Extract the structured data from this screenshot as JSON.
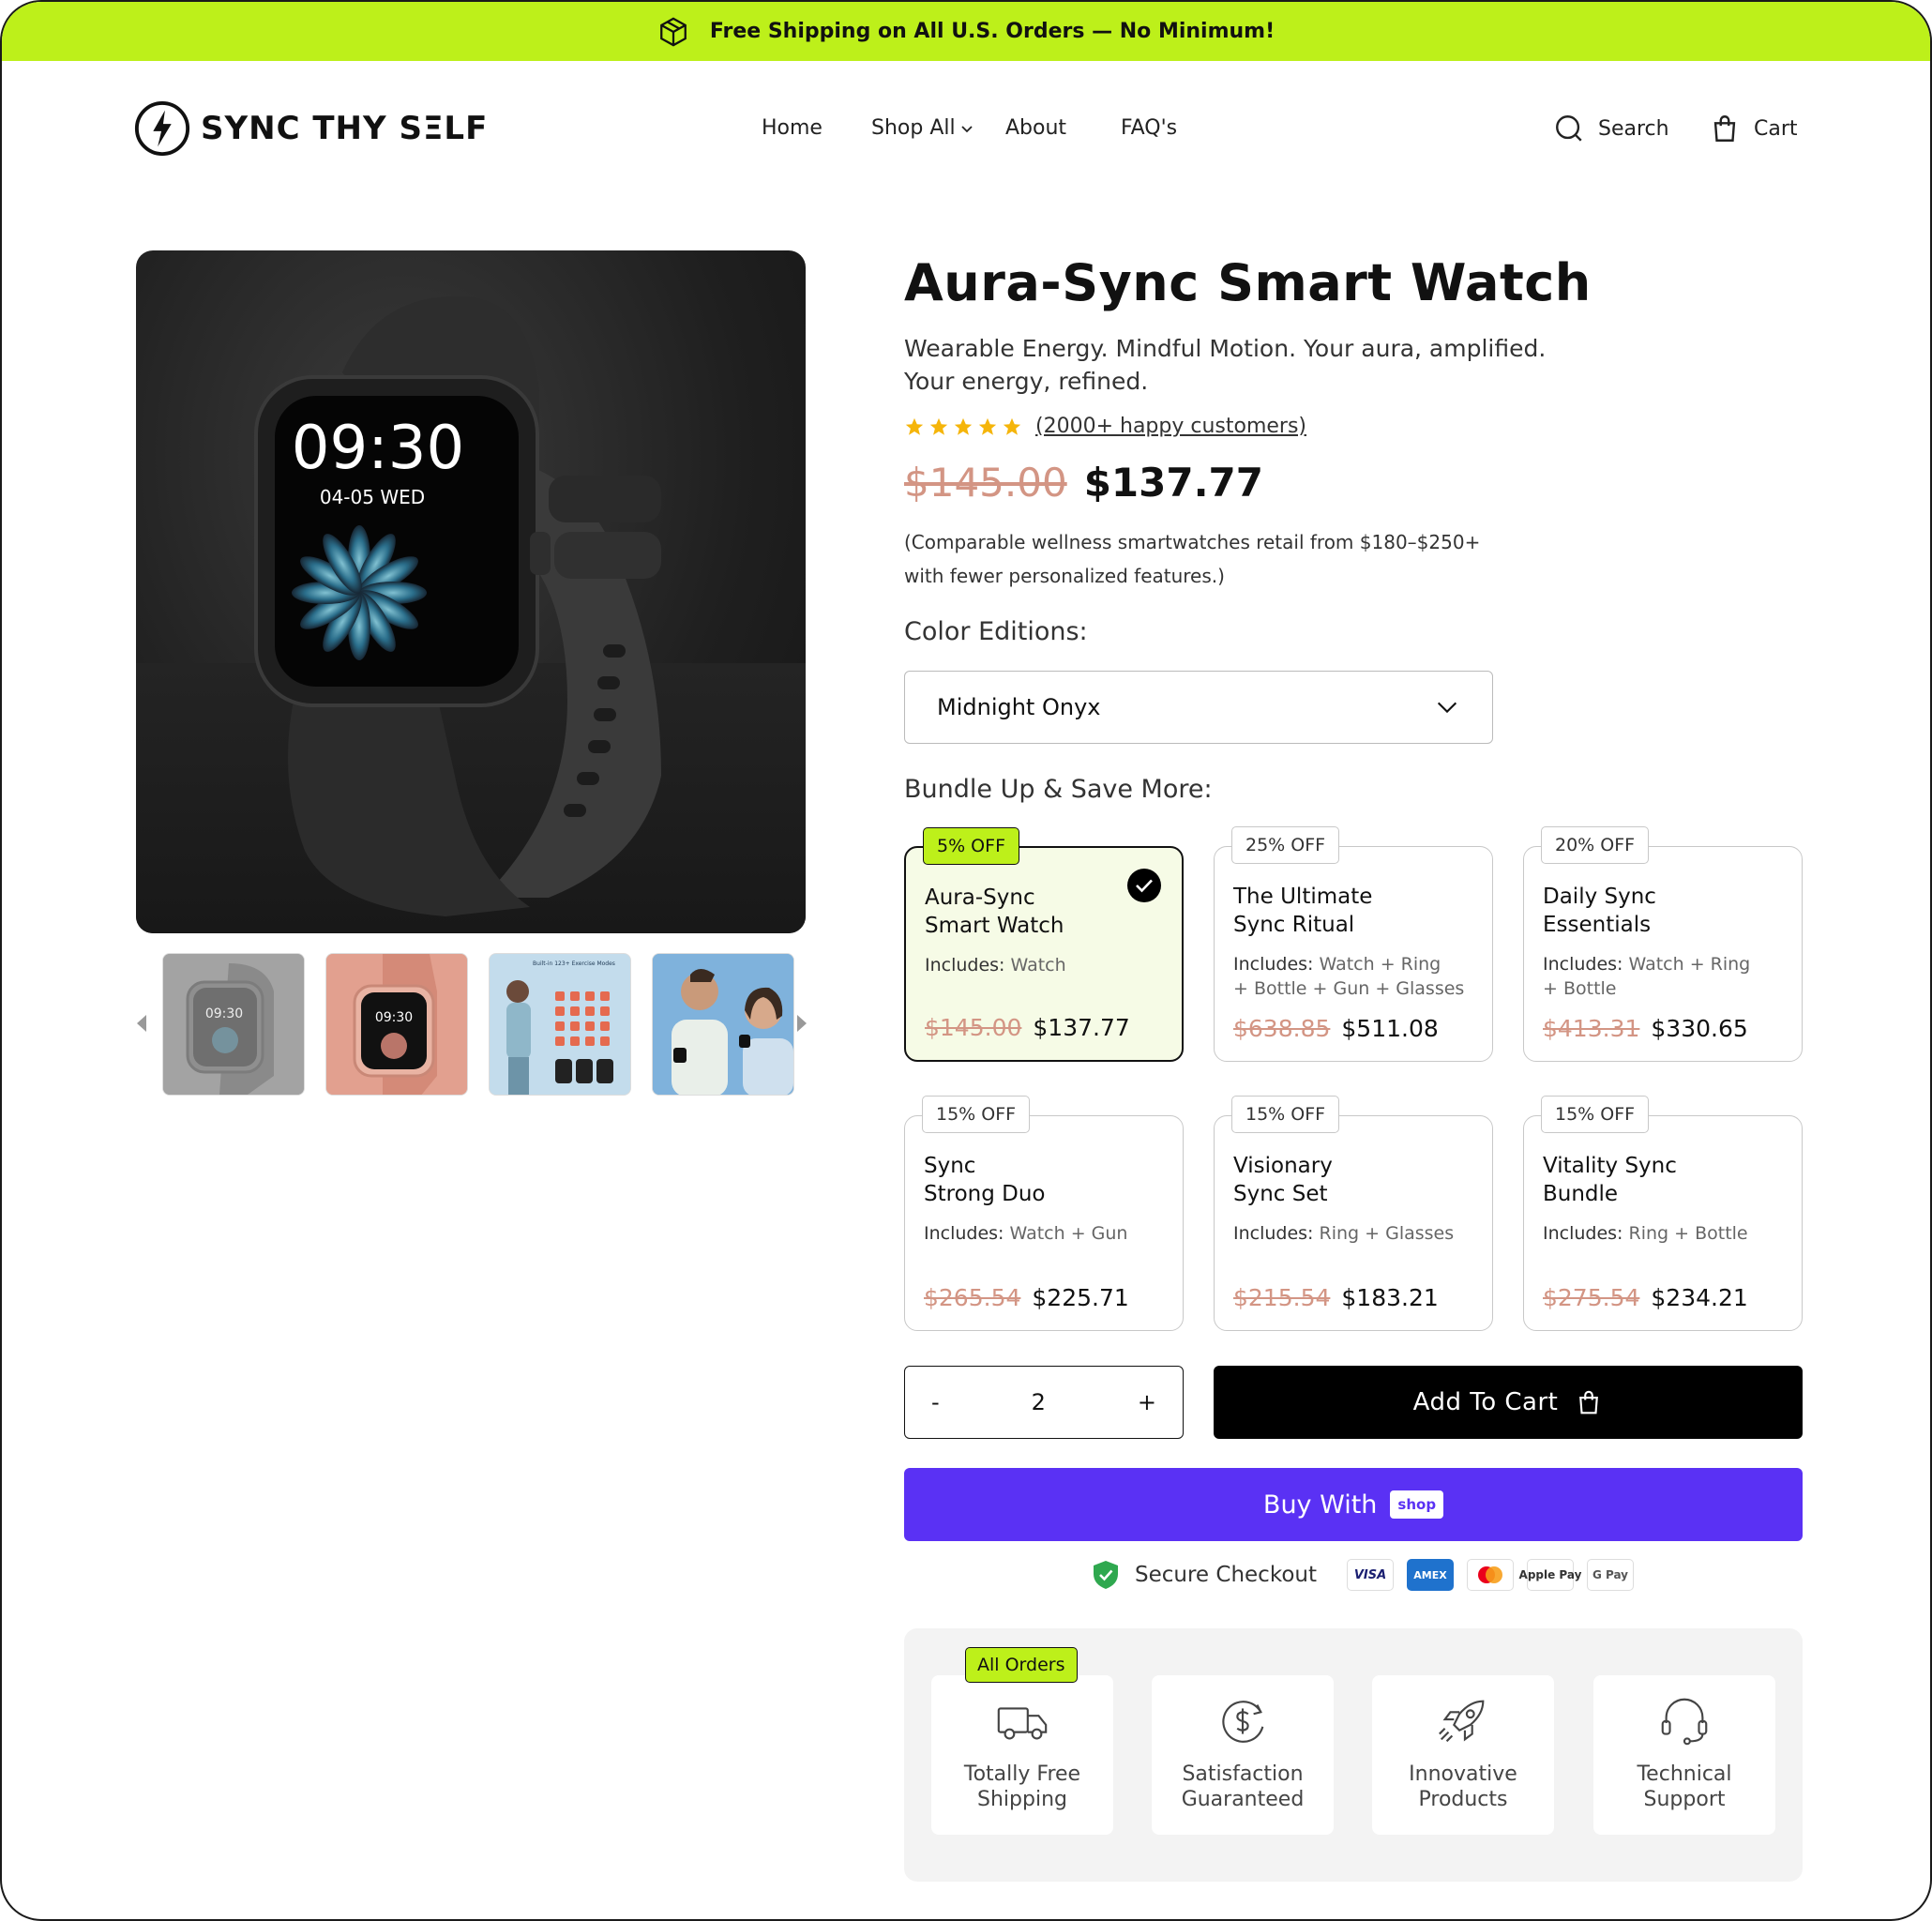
{
  "announcement": {
    "text": "Free Shipping on All U.S. Orders — No Minimum!",
    "icon": "box-icon"
  },
  "brand": {
    "name": "SYNC THY SΞLF",
    "accent": "#bdf01a"
  },
  "nav": {
    "items": [
      "Home",
      "Shop All",
      "About",
      "FAQ's"
    ]
  },
  "header_actions": {
    "search": "Search",
    "cart": "Cart"
  },
  "product": {
    "title": "Aura-Sync Smart Watch",
    "tagline_1": "Wearable Energy. Mindful Motion. Your aura, amplified.",
    "tagline_2": "Your energy, refined.",
    "rating_stars": 5,
    "rating_text": "(2000+ happy customers)",
    "price_old": "$145.00",
    "price_new": "$137.77",
    "comparable_1": "(Comparable wellness smartwatches retail from $180–$250+",
    "comparable_2": "with fewer personalized features.)",
    "main_image": {
      "time": "09:30",
      "date": "04-05 WED"
    },
    "thumbs": [
      {
        "time": "09:30"
      },
      {
        "time": "09:30"
      },
      {
        "heading": "Built-in 123+ Exercise Modes"
      },
      {}
    ]
  },
  "color": {
    "label": "Color Editions:",
    "selected": "Midnight Onyx"
  },
  "bundles": {
    "label": "Bundle Up & Save More:",
    "items": [
      {
        "badge": "5% OFF",
        "title": "Aura-Sync\nSmart Watch",
        "includes_label": "Includes:",
        "includes": " Watch",
        "old": "$145.00",
        "new": "$137.77",
        "selected": true
      },
      {
        "badge": "25% OFF",
        "title": "The Ultimate\nSync Ritual",
        "includes_label": "Includes:",
        "includes": " Watch + Ring\n+ Bottle + Gun + Glasses",
        "old": "$638.85",
        "new": "$511.08",
        "selected": false
      },
      {
        "badge": "20% OFF",
        "title": "Daily Sync\nEssentials",
        "includes_label": "Includes:",
        "includes": " Watch + Ring\n+ Bottle",
        "old": "$413.31",
        "new": "$330.65",
        "selected": false
      },
      {
        "badge": "15% OFF",
        "title": "Sync\nStrong Duo",
        "includes_label": "Includes:",
        "includes": " Watch + Gun",
        "old": "$265.54",
        "new": "$225.71",
        "selected": false
      },
      {
        "badge": "15% OFF",
        "title": "Visionary\nSync Set",
        "includes_label": "Includes:",
        "includes": " Ring + Glasses",
        "old": "$215.54",
        "new": "$183.21",
        "selected": false
      },
      {
        "badge": "15% OFF",
        "title": "Vitality Sync\nBundle",
        "includes_label": "Includes:",
        "includes": " Ring + Bottle",
        "old": "$275.54",
        "new": "$234.21",
        "selected": false
      }
    ]
  },
  "quantity": {
    "minus": "-",
    "value": "2",
    "plus": "+"
  },
  "actions": {
    "add_to_cart": "Add To Cart",
    "buy_with": "Buy With",
    "shop_pill": "shop"
  },
  "secure": {
    "text": "Secure Checkout",
    "payments": [
      "VISA",
      "AMEX",
      "mastercard",
      "Apple Pay",
      "G Pay"
    ]
  },
  "perks": {
    "tag": "All Orders",
    "items": [
      {
        "label": "Totally Free\nShipping",
        "icon": "truck-icon"
      },
      {
        "label": "Satisfaction\nGuaranteed",
        "icon": "money-back-icon"
      },
      {
        "label": "Innovative\nProducts",
        "icon": "rocket-icon"
      },
      {
        "label": "Technical\nSupport",
        "icon": "headset-icon"
      }
    ]
  },
  "colors": {
    "price_old": "#d39584",
    "shop_purple": "#5a31f4",
    "selected_bg": "#f6fbe6"
  }
}
